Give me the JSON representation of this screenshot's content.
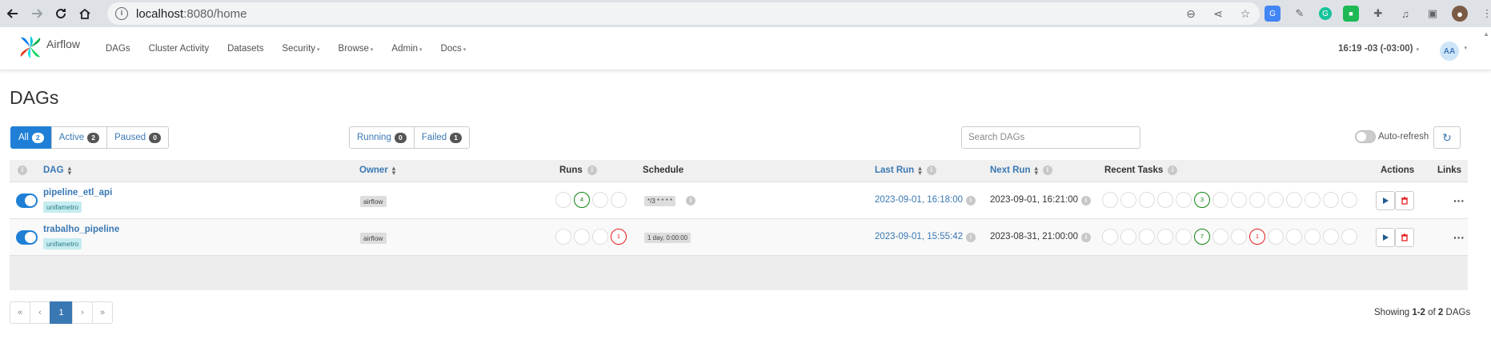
{
  "browser": {
    "url_host": "localhost",
    "url_rest": ":8080/home"
  },
  "navbar": {
    "brand": "Airflow",
    "items": [
      {
        "label": "DAGs",
        "dropdown": false
      },
      {
        "label": "Cluster Activity",
        "dropdown": false
      },
      {
        "label": "Datasets",
        "dropdown": false
      },
      {
        "label": "Security",
        "dropdown": true
      },
      {
        "label": "Browse",
        "dropdown": true
      },
      {
        "label": "Admin",
        "dropdown": true
      },
      {
        "label": "Docs",
        "dropdown": true
      }
    ],
    "time": "16:19 -03 (-03:00)",
    "user_initials": "AA"
  },
  "page": {
    "title": "DAGs"
  },
  "filters": {
    "status": [
      {
        "label": "All",
        "count": "2",
        "active": true
      },
      {
        "label": "Active",
        "count": "2",
        "active": false
      },
      {
        "label": "Paused",
        "count": "0",
        "active": false
      }
    ],
    "runs": [
      {
        "label": "Running",
        "count": "0"
      },
      {
        "label": "Failed",
        "count": "1"
      }
    ],
    "search_placeholder": "Search DAGs",
    "autorefresh_label": "Auto-refresh"
  },
  "table": {
    "headers": {
      "info": "i",
      "dag": "DAG",
      "owner": "Owner",
      "runs": "Runs",
      "schedule": "Schedule",
      "last_run": "Last Run",
      "next_run": "Next Run",
      "recent_tasks": "Recent Tasks",
      "actions": "Actions",
      "links": "Links"
    },
    "rows": [
      {
        "name": "pipeline_etl_api",
        "tag": "unifametro",
        "owner": "airflow",
        "runs": [
          "",
          "4",
          "",
          ""
        ],
        "runs_state": [
          "none",
          "success",
          "none",
          "none"
        ],
        "schedule": "*/3 * * * *",
        "last_run": "2023-09-01, 16:18:00",
        "next_run": "2023-09-01, 16:21:00",
        "tasks": [
          "",
          "",
          "",
          "",
          "",
          "3",
          "",
          "",
          "",
          "",
          "",
          "",
          "",
          ""
        ],
        "tasks_state": [
          "none",
          "none",
          "none",
          "none",
          "none",
          "success",
          "none",
          "none",
          "none",
          "none",
          "none",
          "none",
          "none",
          "none"
        ]
      },
      {
        "name": "trabalho_pipeline",
        "tag": "unifametro",
        "owner": "airflow",
        "runs": [
          "",
          "",
          "",
          "1"
        ],
        "runs_state": [
          "none",
          "none",
          "none",
          "failed"
        ],
        "schedule": "1 day, 0:00:00",
        "last_run": "2023-09-01, 15:55:42",
        "next_run": "2023-08-31, 21:00:00",
        "tasks": [
          "",
          "",
          "",
          "",
          "",
          "7",
          "",
          "",
          "1",
          "",
          "",
          "",
          "",
          ""
        ],
        "tasks_state": [
          "none",
          "none",
          "none",
          "none",
          "none",
          "success",
          "none",
          "none",
          "failed",
          "none",
          "none",
          "none",
          "none",
          "none"
        ]
      }
    ]
  },
  "pagination": {
    "first": "«",
    "prev": "‹",
    "current": "1",
    "next": "›",
    "last": "»"
  },
  "showing": {
    "prefix": "Showing ",
    "range": "1-2",
    "of": " of ",
    "total": "2",
    "suffix": " DAGs"
  },
  "colors": {
    "accent": "#1f7fd6",
    "link": "#3a78b3",
    "success": "#108510",
    "failed": "#e31d1d"
  }
}
